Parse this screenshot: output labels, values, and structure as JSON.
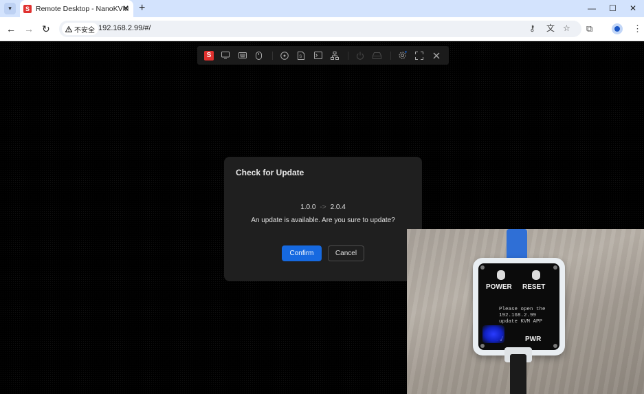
{
  "browser": {
    "tab_title": "Remote Desktop - NanoKVM",
    "tab_favicon_letter": "S",
    "new_tab_label": "+",
    "security_label": "不安全",
    "url": "192.168.2.99/#/"
  },
  "kvm_toolbar": {
    "logo_letter": "S",
    "items": [
      "screen-icon",
      "keyboard-icon",
      "mouse-icon",
      "image-icon",
      "script-icon",
      "terminal-icon",
      "network-icon",
      "power-icon",
      "storage-icon",
      "settings-icon",
      "fullscreen-icon",
      "close-icon"
    ]
  },
  "modal": {
    "title": "Check for Update",
    "current_version": "1.0.0",
    "arrow": "->",
    "new_version": "2.0.4",
    "message": "An update is available. Are you sure to update?",
    "confirm_label": "Confirm",
    "cancel_label": "Cancel"
  },
  "camera": {
    "power_label": "POWER",
    "reset_label": "RESET",
    "oled_text": "Please open the\n192.168.2.99\nupdate KVM APP",
    "led_5v_label": "5V",
    "pwr_label": "PWR"
  },
  "colors": {
    "accent": "#1669e0",
    "brand_red": "#e0312f",
    "tab_strip": "#d3e3fd"
  }
}
